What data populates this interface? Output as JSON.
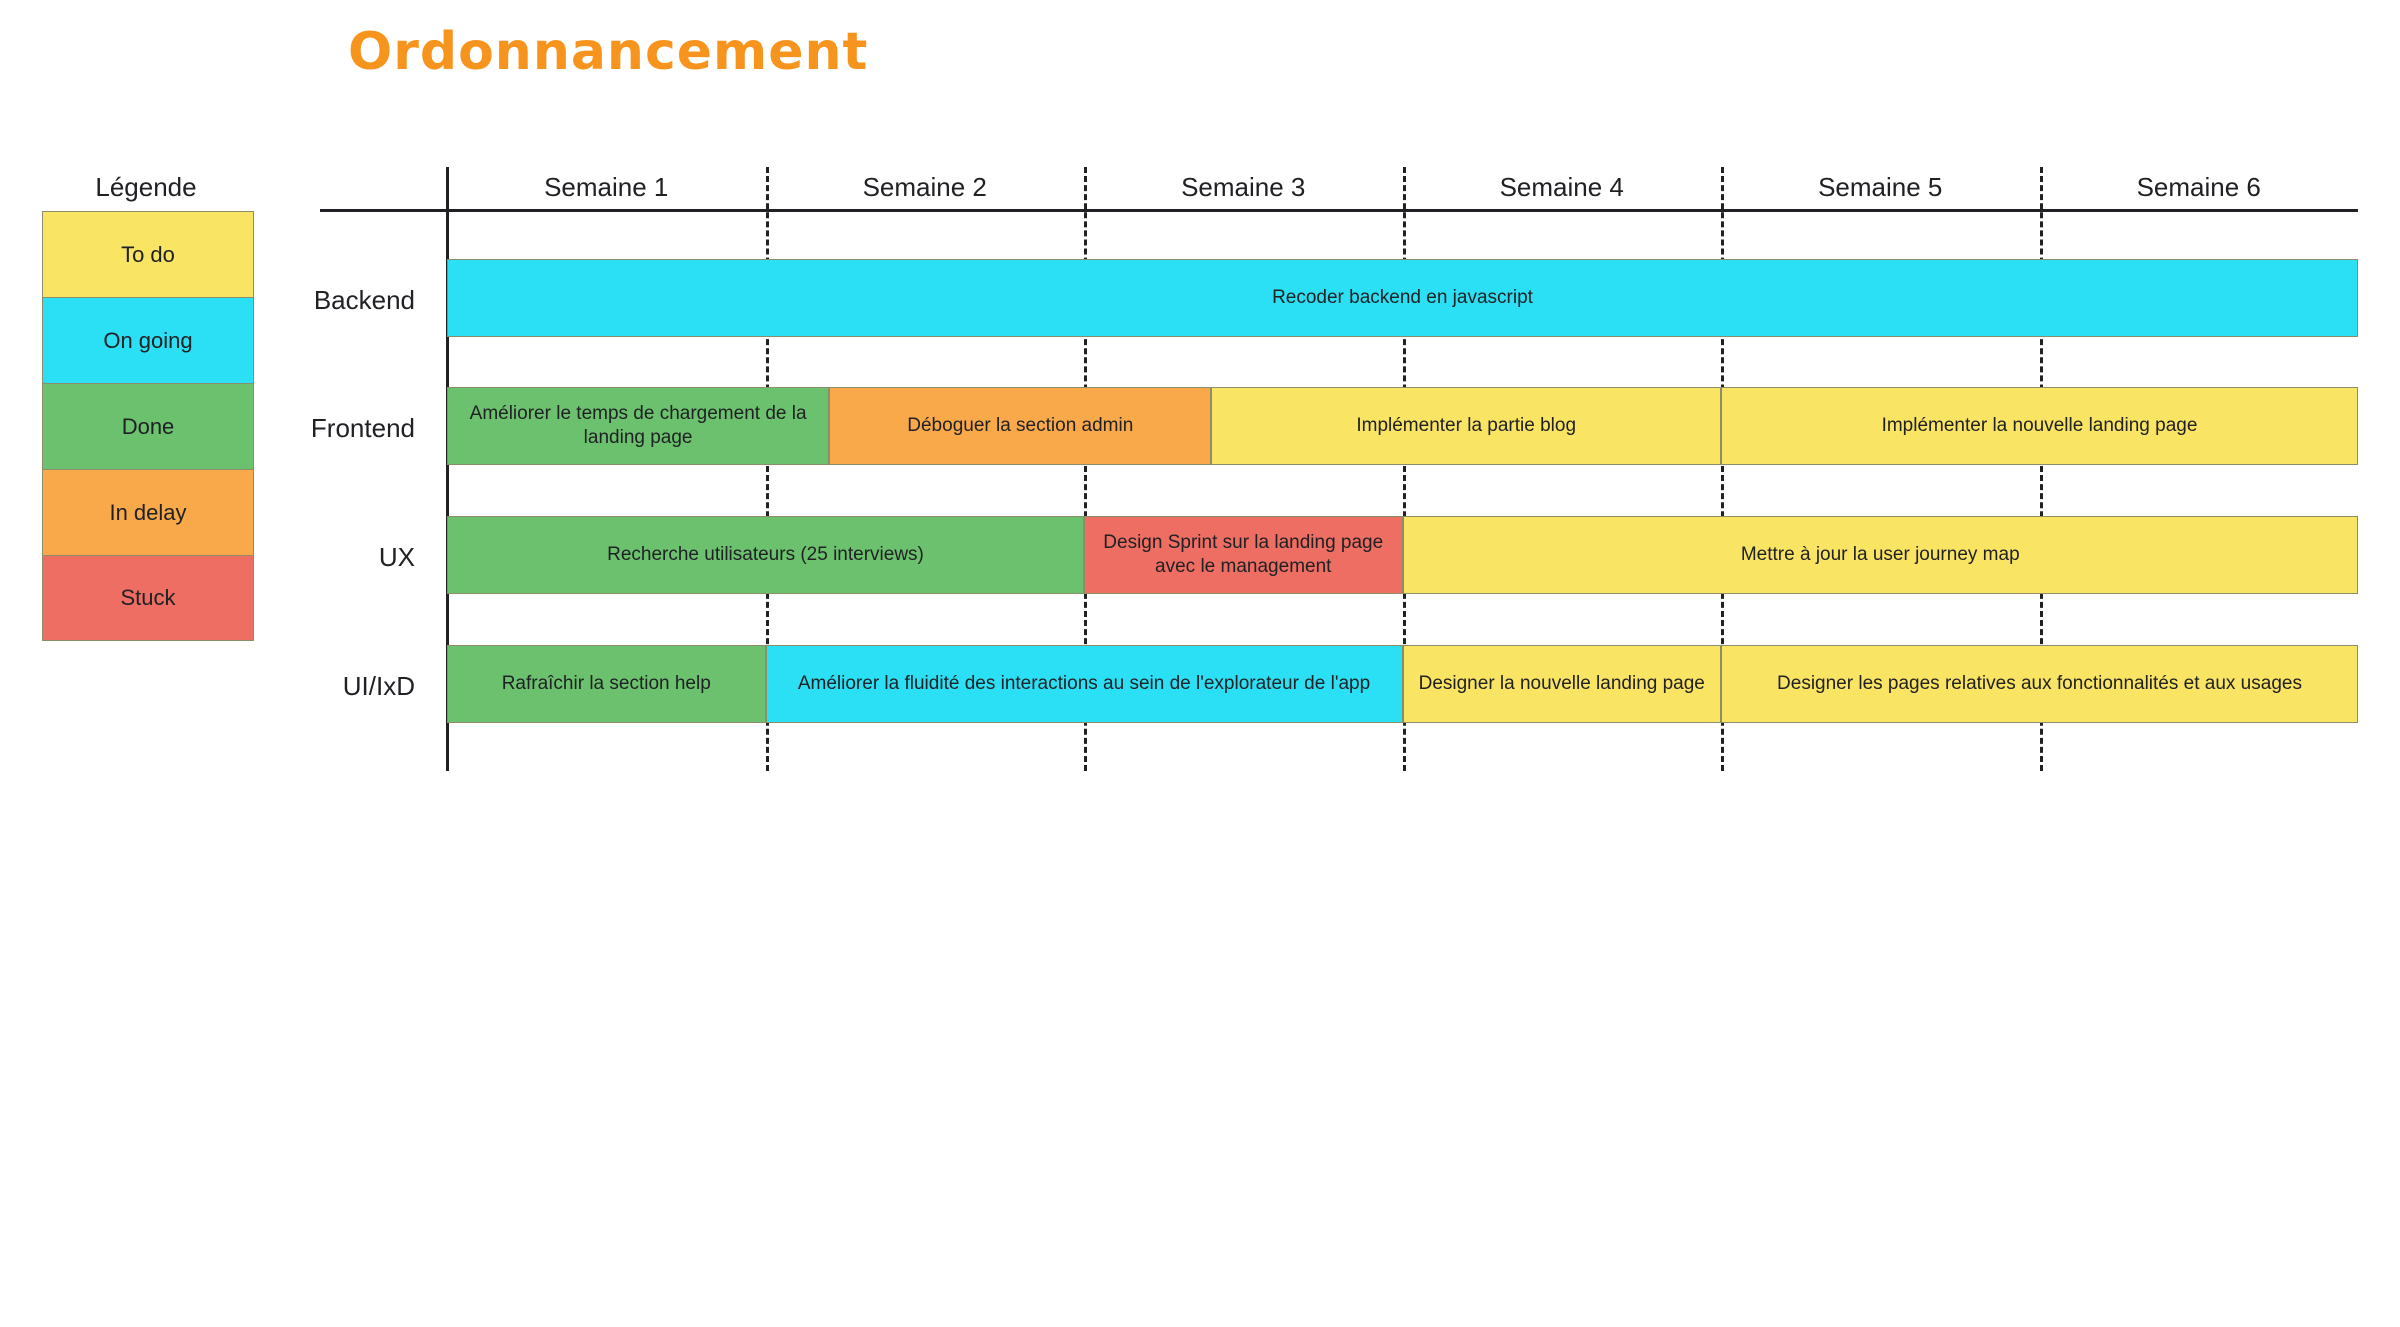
{
  "title": "Ordonnancement",
  "legend": {
    "title": "Légende",
    "items": [
      {
        "label": "To do",
        "color": "#F9E563"
      },
      {
        "label": "On going",
        "color": "#2BE0F5"
      },
      {
        "label": "Done",
        "color": "#6CC16E"
      },
      {
        "label": "In delay",
        "color": "#F9A94A"
      },
      {
        "label": "Stuck",
        "color": "#EE6E63"
      }
    ]
  },
  "chart_data": {
    "type": "bar",
    "title": "Ordonnancement",
    "xlabel": "",
    "ylabel": "",
    "grid": true,
    "legend_position": "left",
    "x_axis": {
      "unit": "Semaine",
      "tick_labels": [
        "Semaine 1",
        "Semaine 2",
        "Semaine 3",
        "Semaine 4",
        "Semaine 5",
        "Semaine 6"
      ],
      "xlim": [
        0,
        6
      ]
    },
    "categories": [
      "Backend",
      "Frontend",
      "UX",
      "UI/IxD"
    ],
    "status_colors": {
      "To do": "#F9E563",
      "On going": "#2BE0F5",
      "Done": "#6CC16E",
      "In delay": "#F9A94A",
      "Stuck": "#EE6E63"
    },
    "series": [
      {
        "name": "Backend",
        "tasks": [
          {
            "label": "Recoder backend en javascript",
            "status": "On going",
            "start": 0.0,
            "end": 6.0
          }
        ]
      },
      {
        "name": "Frontend",
        "tasks": [
          {
            "label": "Améliorer le temps de chargement de la landing page",
            "status": "Done",
            "start": 0.0,
            "end": 1.2
          },
          {
            "label": "Déboguer la section admin",
            "status": "In delay",
            "start": 1.2,
            "end": 2.4
          },
          {
            "label": "Implémenter la partie blog",
            "status": "To do",
            "start": 2.4,
            "end": 4.0
          },
          {
            "label": "Implémenter la nouvelle landing page",
            "status": "To do",
            "start": 4.0,
            "end": 6.0
          }
        ]
      },
      {
        "name": "UX",
        "tasks": [
          {
            "label": "Recherche utilisateurs (25 interviews)",
            "status": "Done",
            "start": 0.0,
            "end": 2.0
          },
          {
            "label": "Design Sprint sur la landing page avec le management",
            "status": "Stuck",
            "start": 2.0,
            "end": 3.0
          },
          {
            "label": "Mettre à jour la user journey map",
            "status": "To do",
            "start": 3.0,
            "end": 6.0
          }
        ]
      },
      {
        "name": "UI/IxD",
        "tasks": [
          {
            "label": "Rafraîchir la section help",
            "status": "Done",
            "start": 0.0,
            "end": 1.0
          },
          {
            "label": "Améliorer la fluidité des interactions au sein de l'explorateur de l'app",
            "status": "On going",
            "start": 1.0,
            "end": 3.0
          },
          {
            "label": "Designer la nouvelle landing page",
            "status": "To do",
            "start": 3.0,
            "end": 4.0
          },
          {
            "label": "Designer les pages relatives aux fonctionnalités et aux usages",
            "status": "To do",
            "start": 4.0,
            "end": 6.0
          }
        ]
      }
    ]
  }
}
